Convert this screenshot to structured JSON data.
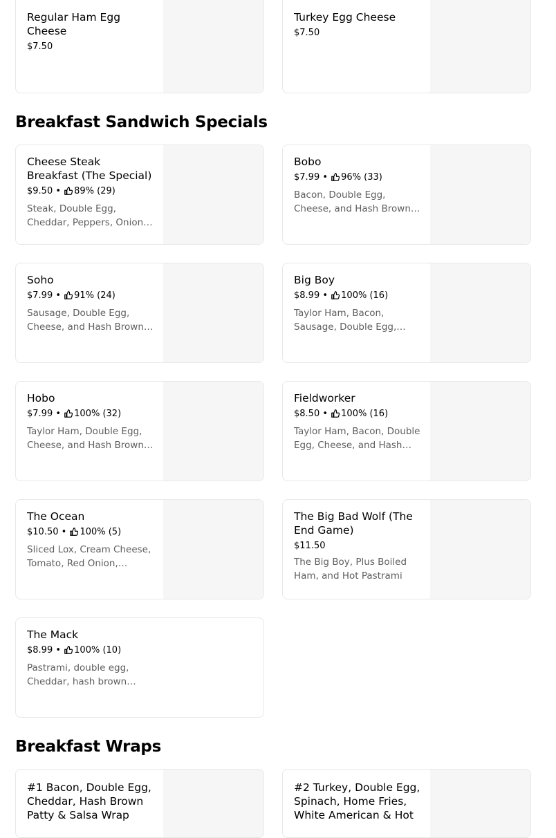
{
  "top_items": [
    {
      "name": "Regular Ham Egg Cheese",
      "price": "$7.50"
    },
    {
      "name": "Turkey Egg Cheese",
      "price": "$7.50"
    }
  ],
  "sections": {
    "specials": {
      "title": "Breakfast Sandwich Specials"
    },
    "wraps": {
      "title": "Breakfast Wraps"
    }
  },
  "specials_items": [
    {
      "name": "Cheese Steak Breakfast (The Special)",
      "price": "$9.50",
      "rating": "89% (29)",
      "description": "Steak, Double Egg, Cheddar, Peppers, Onions, and Hash…"
    },
    {
      "name": "Bobo",
      "price": "$7.99",
      "rating": "96% (33)",
      "description": "Bacon, Double Egg, Cheese, and Hash Brown Patty"
    },
    {
      "name": "Soho",
      "price": "$7.99",
      "rating": "91% (24)",
      "description": "Sausage, Double Egg, Cheese, and Hash Brown…"
    },
    {
      "name": "Big Boy",
      "price": "$8.99",
      "rating": "100% (16)",
      "description": "Taylor Ham, Bacon, Sausage, Double Egg,…"
    },
    {
      "name": "Hobo",
      "price": "$7.99",
      "rating": "100% (32)",
      "description": "Taylor Ham, Double Egg, Cheese, and Hash Brown…"
    },
    {
      "name": "Fieldworker",
      "price": "$8.50",
      "rating": "100% (16)",
      "description": "Taylor Ham, Bacon, Double Egg, Cheese, and Hash…"
    },
    {
      "name": "The Ocean",
      "price": "$10.50",
      "rating": "100% (5)",
      "description": "Sliced Lox, Cream Cheese, Tomato, Red Onion, Capers…"
    },
    {
      "name": "The Big Bad Wolf (The End Game)",
      "price": "$11.50",
      "rating": "",
      "description": "The Big Boy, Plus Boiled Ham, and Hot Pastrami"
    },
    {
      "name": "The Mack",
      "price": "$8.99",
      "rating": "100% (10)",
      "description": "Pastrami, double egg, Cheddar, hash brown patty,…"
    }
  ],
  "wraps_items": [
    {
      "name": "#1 Bacon, Double Egg, Cheddar, Hash Brown Patty & Salsa Wrap"
    },
    {
      "name": "#2 Turkey, Double Egg, Spinach, Home Fries, White American & Hot"
    }
  ]
}
